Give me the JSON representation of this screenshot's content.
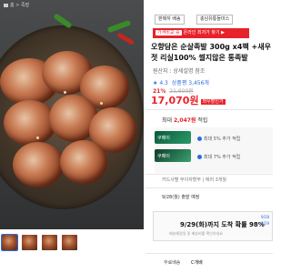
{
  "breadcrumb": {
    "home": "홈",
    "sep": ">",
    "item": "족발"
  },
  "tags": {
    "left": "판매자 배송",
    "seller": "충남유통들마스"
  },
  "banner": {
    "lead": "가격비교 중",
    "text": "온라인 최저가 찾기 ▶"
  },
  "product": {
    "title": "오향담은 순살족발 300g x4팩 +새우젓 리실100% 썰지않은 통족발",
    "brand": "원산지 : 상세설명 참조",
    "rating": "4.3",
    "reviews": "상품평 3,456개",
    "discount_pct": "21%",
    "original_price": "21,600원",
    "price": "17,070원",
    "price_label": "와우할인가"
  },
  "points": {
    "label": "최대",
    "amount": "2,047원",
    "suffix": "적립",
    "card1": "쿠페이",
    "card2": "쿠페이",
    "benefit1": "최대 5% 추가 적립",
    "benefit2": "최대 7% 추가 적립"
  },
  "card_line": "카드사별 무이자할부  |  에러 3개월",
  "shipping": {
    "date_row": "9/28(월) 출발 예정",
    "main": "9/29(화)까지 도착 확률 98%",
    "note": "배송예정일 및 배송비를 확인하세요",
    "side": [
      "9/28",
      "9/29"
    ],
    "label": "무료배송",
    "value": "C개배"
  }
}
